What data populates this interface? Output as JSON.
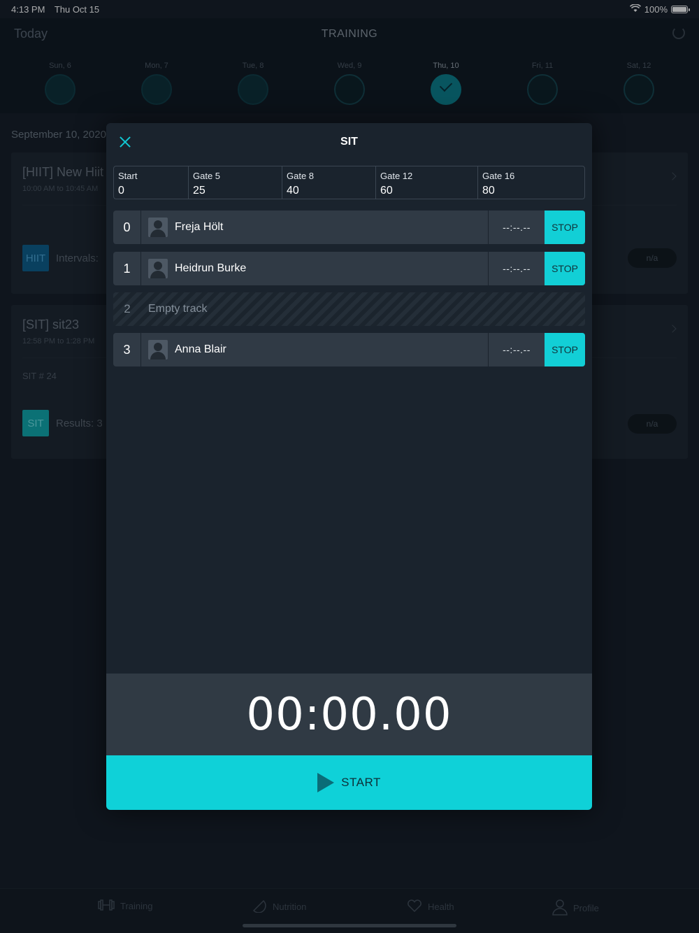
{
  "status_bar": {
    "time": "4:13 PM",
    "date": "Thu Oct 15",
    "battery": "100%"
  },
  "header": {
    "today_label": "Today",
    "title": "TRAINING"
  },
  "week": [
    {
      "label": "Sun, 6"
    },
    {
      "label": "Mon, 7"
    },
    {
      "label": "Tue, 8"
    },
    {
      "label": "Wed, 9"
    },
    {
      "label": "Thu, 10"
    },
    {
      "label": "Fri, 11"
    },
    {
      "label": "Sat, 12"
    }
  ],
  "background": {
    "date_heading": "September 10, 2020",
    "cards": [
      {
        "title": "[HIIT] New Hiit",
        "subtitle": "10:00 AM to 10:45 AM",
        "tag": "HIIT",
        "tag_color": "#0b5f8a",
        "tag_text": "Intervals:",
        "status": "n/a"
      },
      {
        "title": "[SIT] sit23",
        "subtitle": "12:58 PM to 1:28 PM",
        "extra": "SIT # 24",
        "tag": "SIT",
        "tag_color": "#0fa9ad",
        "tag_text": "Results: 3",
        "status": "n/a"
      }
    ]
  },
  "modal": {
    "title": "SIT",
    "gates": [
      {
        "name": "Start",
        "value": "0"
      },
      {
        "name": "Gate 5",
        "value": "25"
      },
      {
        "name": "Gate 8",
        "value": "40"
      },
      {
        "name": "Gate 12",
        "value": "60"
      },
      {
        "name": "Gate 16",
        "value": "80"
      }
    ],
    "lanes": [
      {
        "track": "0",
        "name": "Freja Hölt",
        "time": "--:--.--",
        "action": "STOP"
      },
      {
        "track": "1",
        "name": "Heidrun Burke",
        "time": "--:--.--",
        "action": "STOP"
      },
      {
        "track": "2",
        "empty_label": "Empty track"
      },
      {
        "track": "3",
        "name": "Anna Blair",
        "time": "--:--.--",
        "action": "STOP"
      }
    ],
    "timer": "00:00.00",
    "start_label": "START"
  },
  "tabbar": [
    {
      "label": "Training",
      "icon": "dumbbell-icon"
    },
    {
      "label": "Nutrition",
      "icon": "nutrition-icon"
    },
    {
      "label": "Health",
      "icon": "heart-icon"
    },
    {
      "label": "Profile",
      "icon": "person-icon"
    }
  ],
  "colors": {
    "accent": "#0fd1d8",
    "modal_bg": "#1a232d",
    "lane_bg": "#303a45"
  }
}
